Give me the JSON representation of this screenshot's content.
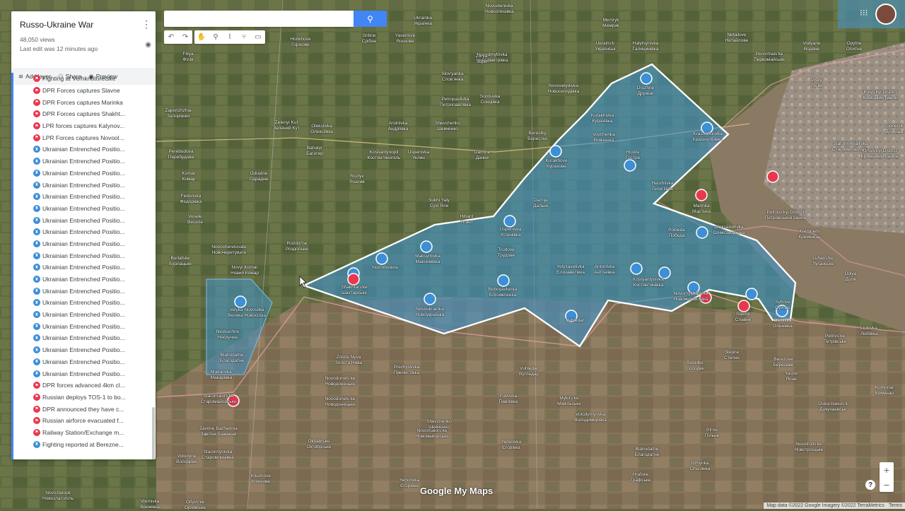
{
  "panel": {
    "title": "Russo-Ukraine War",
    "views": "48,050 views",
    "last_edit": "Last edit was 12 minutes ago",
    "add_layer": "Add layer",
    "share": "Share",
    "preview": "Preview",
    "items": [
      {
        "label": "Fighting at Verhknotoretske",
        "color": "red"
      },
      {
        "label": "DPR Forces captures Slavne",
        "color": "red"
      },
      {
        "label": "DPR Forces captures Marinka",
        "color": "red"
      },
      {
        "label": "DPR Forces captures Shakht...",
        "color": "red"
      },
      {
        "label": "LPR forces captures Kalynov...",
        "color": "red"
      },
      {
        "label": "LPR Forces captures Novool...",
        "color": "red"
      },
      {
        "label": "Ukrainian Entrenched Positio...",
        "color": "blue"
      },
      {
        "label": "Ukrainian Entrenched Positio...",
        "color": "blue"
      },
      {
        "label": "Ukrainian Entrenched Positio...",
        "color": "blue"
      },
      {
        "label": "Ukrainian Entrenched Positio...",
        "color": "blue"
      },
      {
        "label": "Ukrainian Entrenched Positio...",
        "color": "blue"
      },
      {
        "label": "Ukrainian Entrenched Positio...",
        "color": "blue"
      },
      {
        "label": "Ukrainian Entrenched Positio...",
        "color": "blue"
      },
      {
        "label": "Ukrainian Entrenched Positio...",
        "color": "blue"
      },
      {
        "label": "Ukrainian Entrenched Positio...",
        "color": "blue"
      },
      {
        "label": "Ukrainian Entrenched Positio...",
        "color": "blue"
      },
      {
        "label": "Ukrainian Entrenched Positio...",
        "color": "blue"
      },
      {
        "label": "Ukrainian Entrenched Positio...",
        "color": "blue"
      },
      {
        "label": "Ukrainian Entrenched Positio...",
        "color": "blue"
      },
      {
        "label": "Ukrainian Entrenched Positio...",
        "color": "blue"
      },
      {
        "label": "Ukrainian Entrenched Positio...",
        "color": "blue"
      },
      {
        "label": "Ukrainian Entrenched Positio...",
        "color": "blue"
      },
      {
        "label": "Ukrainian Entrenched Positio...",
        "color": "blue"
      },
      {
        "label": "Ukrainian Entrenched Positio...",
        "color": "blue"
      },
      {
        "label": "Ukrainian Entrenched Positio...",
        "color": "blue"
      },
      {
        "label": "Ukrainian Entrenched Positio...",
        "color": "blue"
      },
      {
        "label": "DPR forces advanced 4km cl...",
        "color": "red"
      },
      {
        "label": "Russian deploys TOS-1 to bo...",
        "color": "red"
      },
      {
        "label": "DPR announced they have c...",
        "color": "red"
      },
      {
        "label": "Russian airforce evacuated f...",
        "color": "red"
      },
      {
        "label": "Railway Station/Exchange m...",
        "color": "red"
      },
      {
        "label": "Fighting reported at Berezne...",
        "color": "blue"
      }
    ]
  },
  "search": {
    "placeholder": ""
  },
  "footer": {
    "logo": "Google My Maps",
    "attribution": "Map data ©2022 Google Imagery ©2022 TerraMetrics",
    "terms": "Terms"
  },
  "places": [
    {
      "l1": "Ukrainka",
      "l2": "Українка"
    },
    {
      "l1": "Novoolenivka",
      "l2": "Новоолешвка"
    },
    {
      "l1": "Horikhove",
      "l2": "Горіхове"
    },
    {
      "l1": "Sribne",
      "l2": "Срібне"
    },
    {
      "l1": "Yasenove",
      "l2": "Ясенове"
    },
    {
      "l1": "Filiya",
      "l2": "Філія"
    },
    {
      "l1": "Novodmytrivka",
      "l2": "Новодмитрівка"
    },
    {
      "l1": "Zorya",
      "l2": "Зоря"
    },
    {
      "l1": "Slov'yanka",
      "l2": "Слов'янка"
    },
    {
      "l1": "Petropavlivka",
      "l2": "Петропавлівка"
    },
    {
      "l1": "Sontsivka",
      "l2": "Сонцівка"
    },
    {
      "l1": "Novoselydivka",
      "l2": "Новоселидівка"
    },
    {
      "l1": "Zaporizhzhia",
      "l2": "Запоріжжя"
    },
    {
      "l1": "Zelenyi Kut",
      "l2": "Зелений Кут"
    },
    {
      "l1": "Oleksiivka",
      "l2": "Олексіївка"
    },
    {
      "l1": "Andriivka",
      "l2": "Андріївка"
    },
    {
      "l1": "Shevchenko",
      "l2": "Шевченко"
    },
    {
      "l1": "Berestky",
      "l2": "Берестки"
    },
    {
      "l1": "Perebudova",
      "l2": "Перебудова"
    },
    {
      "l1": "Bahatyr",
      "l2": "Багатир"
    },
    {
      "l1": "Kostiantynopil",
      "l2": "Костянтинопіль"
    },
    {
      "l1": "Uspenivka",
      "l2": "Уклин"
    },
    {
      "l1": "Dachne",
      "l2": "Дачне"
    },
    {
      "l1": "Komar",
      "l2": "Комар"
    },
    {
      "l1": "Odradne",
      "l2": "Одрадне"
    },
    {
      "l1": "Rozlyv",
      "l2": "Розлив"
    },
    {
      "l1": "Fedorivka",
      "l2": "Федорівка"
    },
    {
      "l1": "Sukhi Yaly",
      "l2": "Сухі Яли"
    },
    {
      "l1": "Veselе",
      "l2": "Веселе"
    },
    {
      "l1": "Hihant",
      "l2": "Гігант"
    },
    {
      "l1": "Novocheretuvate",
      "l2": "Новочеретувате"
    },
    {
      "l1": "Rozdol'ne",
      "l2": "Роздольне"
    },
    {
      "l1": "Burlatske",
      "l2": "Бурлацьке"
    },
    {
      "l1": "Novyi Komar",
      "l2": "Новий Комар"
    },
    {
      "l1": "Memryk",
      "l2": "Мемрик"
    },
    {
      "l1": "Ukrains'k",
      "l2": "Українськ"
    },
    {
      "l1": "Halytsynivka",
      "l2": "Галицинівка"
    },
    {
      "l1": "Netailove",
      "l2": "Нетайлове"
    },
    {
      "l1": "Pervomais'ke",
      "l2": "Первомайське"
    },
    {
      "l1": "Vodyane",
      "l2": "Водяне"
    },
    {
      "l1": "Opytne",
      "l2": "Опитне"
    },
    {
      "l1": "Pisky",
      "l2": "Піски"
    },
    {
      "l1": "Kyivs'kyi District",
      "l2": "Київський район"
    },
    {
      "l1": "Staromykhailivka",
      "l2": "Старомихайлівка"
    },
    {
      "l1": "Kirovs'kyi District",
      "l2": "Кіровський район"
    },
    {
      "l1": "Donetsk",
      "l2": "Донецьк"
    },
    {
      "l1": "Petrovs'kyi District",
      "l2": "Петровський район"
    },
    {
      "l1": "Kreminets",
      "l2": "Кремінець"
    },
    {
      "l1": "Oleksandrivka",
      "l2": "Олександрівка"
    },
    {
      "l1": "Marinka",
      "l2": "Мар'їнка"
    },
    {
      "l1": "Luhans'ke",
      "l2": "Луганське"
    },
    {
      "l1": "Dolya",
      "l2": "Доля"
    },
    {
      "l1": "Kurakhivka",
      "l2": "Курахівка"
    },
    {
      "l1": "Druzhne",
      "l2": "Дружне"
    },
    {
      "l1": "Vovchenka",
      "l2": "Вовченка"
    },
    {
      "l1": "Kurakhove",
      "l2": "Курахове"
    },
    {
      "l1": "Hostre",
      "l2": "Гостре"
    },
    {
      "l1": "Krasnohorivka",
      "l2": "Красногорівка"
    },
    {
      "l1": "Heorhiivka",
      "l2": "Георгіївка"
    },
    {
      "l1": "Dal'nje",
      "l2": "Дальнє"
    },
    {
      "l1": "Pobieda",
      "l2": "Победа"
    },
    {
      "l1": "Uspenivka",
      "l2": "Успенівка"
    },
    {
      "l1": "Trudove",
      "l2": "Трудове"
    },
    {
      "l1": "Maksymivka",
      "l2": "Максимівка"
    },
    {
      "l1": "Yelyzavetivka",
      "l2": "Єлизаветівка"
    },
    {
      "l1": "Antonivka",
      "l2": "Антонівка"
    },
    {
      "l1": "Kostyantynivka",
      "l2": "Костянтинівка"
    },
    {
      "l1": "Novomykhailivka",
      "l2": "Новомихайлівка"
    },
    {
      "l1": "Slavne",
      "l2": "Славне"
    },
    {
      "l1": "Syhove",
      "l2": "Сухове"
    },
    {
      "l1": "Olenivka",
      "l2": "Оленівка"
    },
    {
      "l1": "Yasnobolana",
      "l2": ""
    },
    {
      "l1": "Shakhtars'ke",
      "l2": "Шахтарське"
    },
    {
      "l1": "Bohoyavlenka",
      "l2": "Богоявленка"
    },
    {
      "l1": "Novoukrainka",
      "l2": "Новоукраїнка"
    },
    {
      "l1": "Vuhledar",
      "l2": ""
    },
    {
      "l1": "Velyka Novosilka",
      "l2": "Велика Новосілка"
    },
    {
      "l1": "Neskuchne",
      "l2": "Нескучне"
    },
    {
      "l1": "Blahodatne",
      "l2": "Благодатне"
    },
    {
      "l1": "Makarivka",
      "l2": "Макарівка"
    },
    {
      "l1": "Staromaiors'ke",
      "l2": "Старомайорське"
    },
    {
      "l1": "Zolota Nyva",
      "l2": "Золота Нива"
    },
    {
      "l1": "Prechystivka",
      "l2": "Пречистівка"
    },
    {
      "l1": "Vuhledar",
      "l2": "Вугледар"
    },
    {
      "l1": "Novodonets'ke",
      "l2": "Новодонецьке"
    },
    {
      "l1": "Pavlivka",
      "l2": "Павлівка"
    },
    {
      "l1": "Mykil's'ke",
      "l2": "Микільське"
    },
    {
      "l1": "Volodymyrivka",
      "l2": "Володимирівка"
    },
    {
      "l1": "Stepne",
      "l2": "Степне"
    },
    {
      "l1": "Solodke",
      "l2": "Солодке"
    },
    {
      "l1": "Berezove",
      "l2": "Березове"
    },
    {
      "l1": "Komunar",
      "l2": "Комунар"
    },
    {
      "l1": "Yasne",
      "l2": "Ясне"
    },
    {
      "l1": "Dokuchaievs'k",
      "l2": "Докучаєвськ"
    },
    {
      "l1": "Pil'ne",
      "l2": "Пільне"
    },
    {
      "l1": "Novotroits'ke",
      "l2": "Новотроїцьке"
    },
    {
      "l1": "Novodonets'ke",
      "l2": "Новодонецьке"
    },
    {
      "l1": "Shevchenko",
      "l2": "Шевченко"
    },
    {
      "l1": "Novomaiors'ke",
      "l2": "Новомайорське"
    },
    {
      "l1": "Zavitne Bazhannia",
      "l2": "Завітне Бажання"
    },
    {
      "l1": "Staromlynivka",
      "l2": "Старомлинівка"
    },
    {
      "l1": "Oktiabrske",
      "l2": "Октябрське"
    },
    {
      "l1": "Yehorivka",
      "l2": "Єгорівка"
    },
    {
      "l1": "Blahodatne",
      "l2": "Благодатне"
    },
    {
      "l1": "Hrafske",
      "l2": "Графське"
    },
    {
      "l1": "Ol'hynka",
      "l2": "Ольгинка"
    },
    {
      "l1": "Kliuchove",
      "l2": "Ключове"
    },
    {
      "l1": "Yehorivka",
      "l2": "Єгорівка"
    },
    {
      "l1": "Volodyne",
      "l2": "Володине"
    },
    {
      "l1": "Novozlatopil",
      "l2": "Новозлатопіль"
    },
    {
      "l1": "Vremivka",
      "l2": "Времівка"
    },
    {
      "l1": "Orlyvs'ke",
      "l2": "Орлівське"
    },
    {
      "l1": "Petrivs'ke",
      "l2": "Петрівське"
    },
    {
      "l1": "Liubivka",
      "l2": "Любівка"
    }
  ],
  "colors": {
    "accent": "#4285f4",
    "zone_fill": "#3f93c9",
    "zone_stroke": "#ffffff",
    "red_marker": "#e8384f",
    "blue_marker": "#3d8fd6"
  }
}
